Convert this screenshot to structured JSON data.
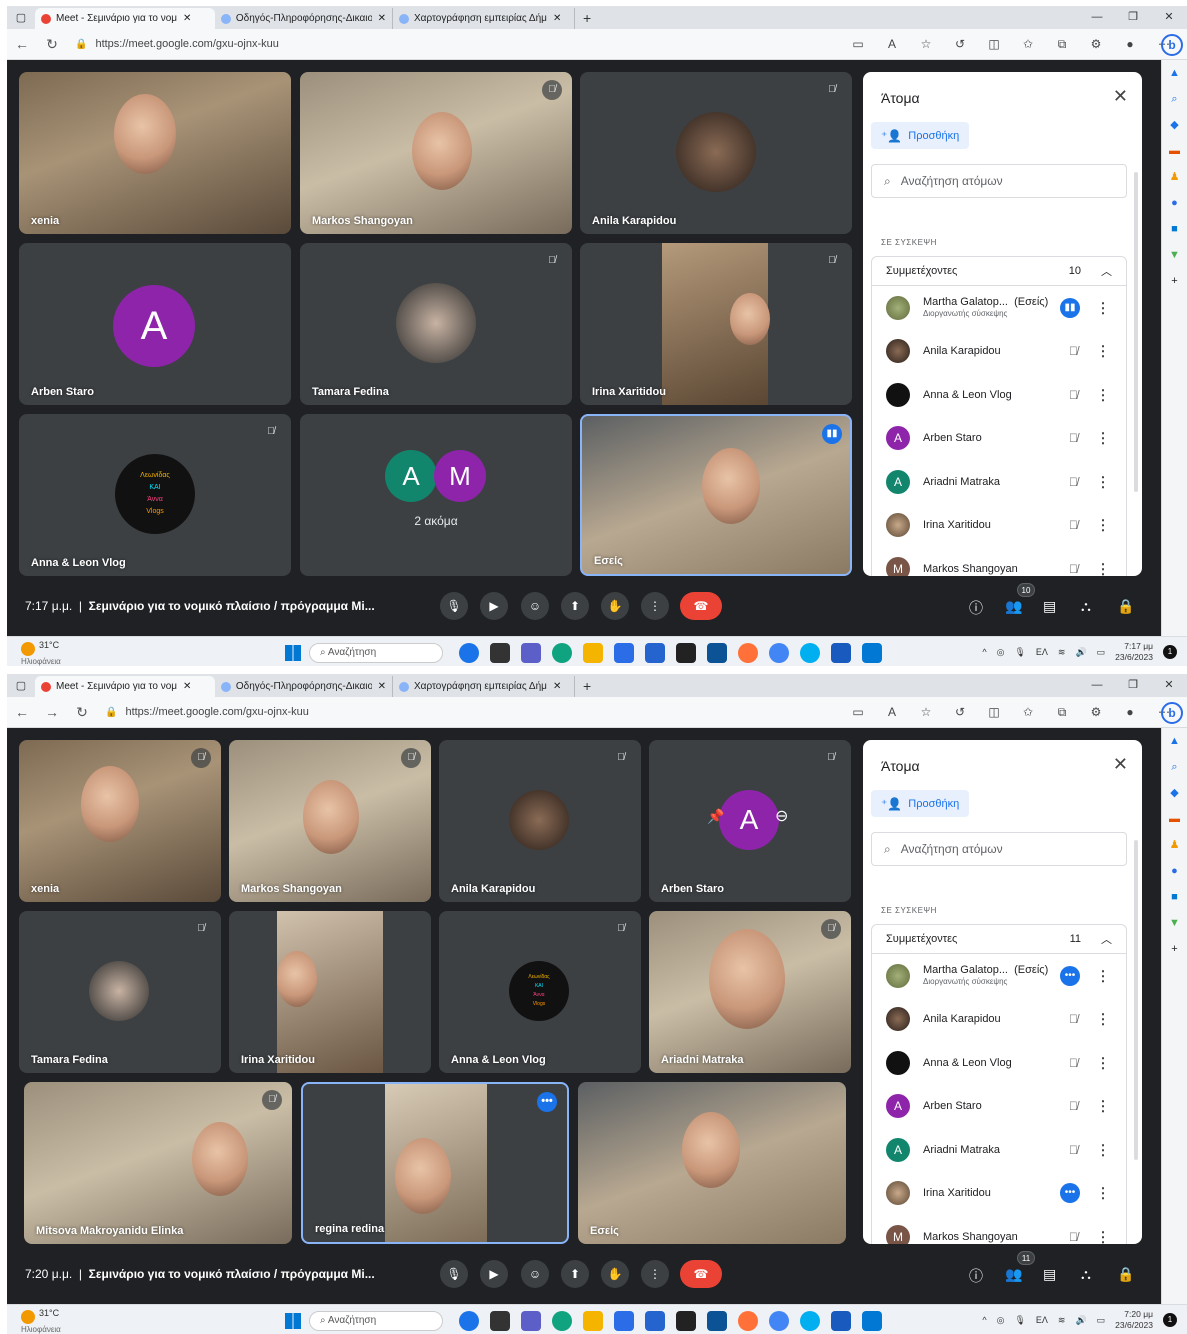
{
  "shots": [
    {
      "tabs": [
        "Meet - Σεμινάριο για το νομ",
        "Οδηγός-Πληροφόρησης-Δικαιο",
        "Χαρτογράφηση εμπειρίας Δήμ"
      ],
      "url": "https://meet.google.com/gxu-ojnx-kuu",
      "tiles": {
        "t1": "xenia",
        "t2": "Markos Shangoyan",
        "t3": "Anila Karapidou",
        "t4": "Arben Staro",
        "t5": "Tamara Fedina",
        "t6": "Irina Xaritidou",
        "t7": "Anna & Leon Vlog",
        "t8": "2 ακόμα",
        "t9": "Εσείς"
      },
      "avatars": {
        "arben": "A",
        "group_a": "A",
        "group_m": "M"
      },
      "logo_text": [
        "Λεωνίδας",
        "ΚΑΙ",
        "Άννα",
        "Vlogs"
      ],
      "panel": {
        "title": "Άτομα",
        "add": "Προσθήκη",
        "search": "Αναζήτηση ατόμων",
        "section": "ΣΕ ΣΥΣΚΕΨΗ",
        "group": "Συμμετέχοντες",
        "count": "10",
        "people": [
          {
            "name": "Martha Galatop...",
            "you": "(Εσείς)",
            "sub": "Διοργανωτής σύσκεψης"
          },
          {
            "name": "Anila Karapidou"
          },
          {
            "name": "Anna & Leon Vlog"
          },
          {
            "name": "Arben Staro",
            "initial": "A"
          },
          {
            "name": "Ariadni Matraka",
            "initial": "A"
          },
          {
            "name": "Irina Xaritidou"
          },
          {
            "name": "Markos Shangoyan",
            "initial": "M"
          }
        ]
      },
      "controls": {
        "time": "7:17 μ.μ.",
        "title": "Σεμινάριο για το νομικό πλαίσιο / πρόγραμμα Mi...",
        "people_badge": "10"
      },
      "taskbar": {
        "temp": "31°C",
        "weather": "Ηλιοφάνεια",
        "search": "Αναζήτηση",
        "lang": "ΕΛ",
        "time": "7:17 μμ",
        "date": "23/6/2023"
      }
    },
    {
      "tabs": [
        "Meet - Σεμινάριο για το νομ",
        "Οδηγός-Πληροφόρησης-Δικαιο",
        "Χαρτογράφηση εμπειρίας Δήμ"
      ],
      "url": "https://meet.google.com/gxu-ojnx-kuu",
      "tiles": {
        "t1": "xenia",
        "t2": "Markos Shangoyan",
        "t3": "Anila Karapidou",
        "t4": "Arben Staro",
        "t5": "Tamara Fedina",
        "t6": "Irina Xaritidou",
        "t7": "Anna & Leon Vlog",
        "t8": "Ariadni Matraka",
        "t9": "Mitsova Makroyanidu Elinka",
        "t10": "regina redina",
        "t11": "Εσείς"
      },
      "avatars": {
        "arben": "A"
      },
      "logo_text": [
        "Λεωνίδας",
        "ΚΑΙ",
        "Άννα",
        "Vlogs"
      ],
      "panel": {
        "title": "Άτομα",
        "add": "Προσθήκη",
        "search": "Αναζήτηση ατόμων",
        "section": "ΣΕ ΣΥΣΚΕΨΗ",
        "group": "Συμμετέχοντες",
        "count": "11",
        "people": [
          {
            "name": "Martha Galatop...",
            "you": "(Εσείς)",
            "sub": "Διοργανωτής σύσκεψης"
          },
          {
            "name": "Anila Karapidou"
          },
          {
            "name": "Anna & Leon Vlog"
          },
          {
            "name": "Arben Staro",
            "initial": "A"
          },
          {
            "name": "Ariadni Matraka",
            "initial": "A"
          },
          {
            "name": "Irina Xaritidou"
          },
          {
            "name": "Markos Shangoyan",
            "initial": "M"
          }
        ]
      },
      "controls": {
        "time": "7:20 μ.μ.",
        "title": "Σεμινάριο για το νομικό πλαίσιο / πρόγραμμα Mi...",
        "people_badge": "11"
      },
      "taskbar": {
        "temp": "31°C",
        "weather": "Ηλιοφάνεια",
        "search": "Αναζήτηση",
        "lang": "ΕΛ",
        "time": "7:20 μμ",
        "date": "23/6/2023"
      }
    }
  ],
  "colors": {
    "meet_bg": "#202124",
    "tile_bg": "#3c4043",
    "accent": "#1a73e8",
    "end_call": "#ea4335",
    "purple_avatar": "#8e24aa",
    "teal_avatar": "#12866d",
    "brown_avatar": "#795548"
  }
}
